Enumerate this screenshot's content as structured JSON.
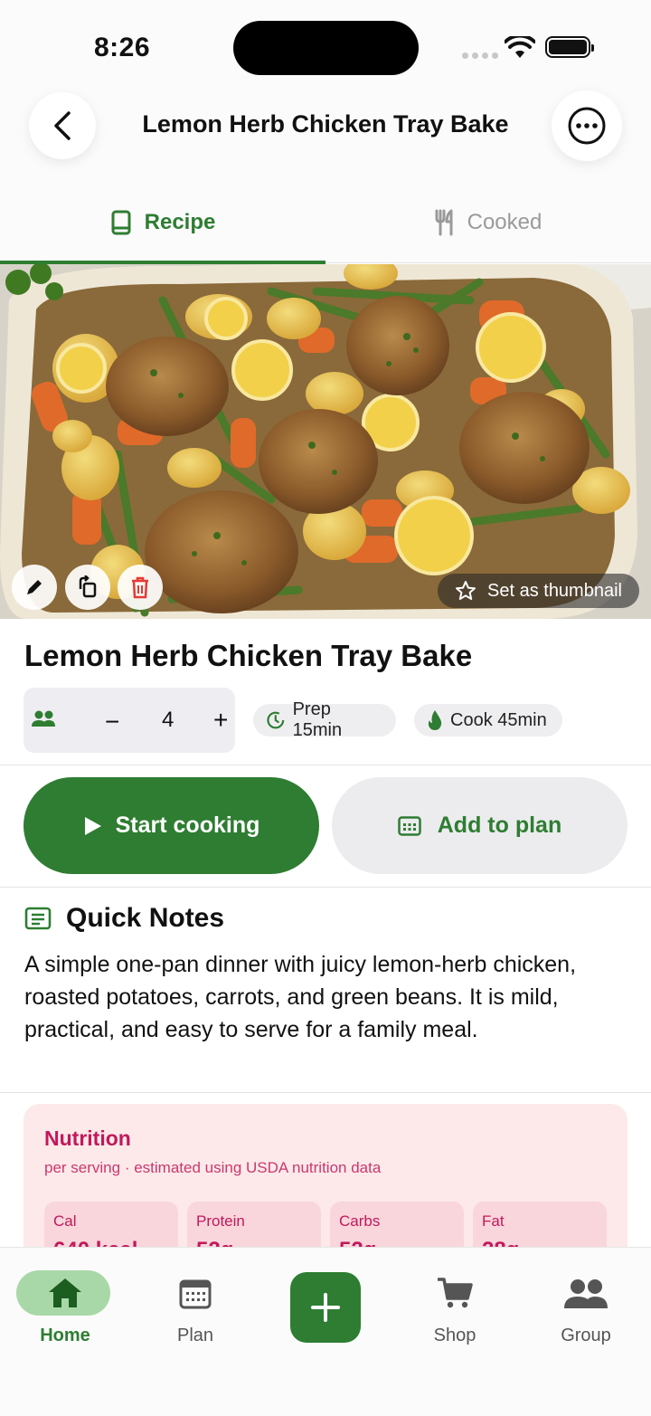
{
  "status": {
    "time": "8:26"
  },
  "header": {
    "title": "Lemon Herb Chicken Tray Bake"
  },
  "tabs": [
    {
      "label": "Recipe",
      "icon": "book-icon",
      "active": true
    },
    {
      "label": "Cooked",
      "icon": "fork-knife-icon",
      "active": false
    }
  ],
  "hero": {
    "thumbnail_label": "Set as thumbnail"
  },
  "recipe": {
    "title": "Lemon Herb Chicken Tray Bake",
    "servings": "4",
    "minus": "−",
    "plus": "+",
    "prep": "Prep 15min",
    "cook": "Cook 45min"
  },
  "actions": {
    "start_cooking": "Start cooking",
    "add_to_plan": "Add to plan"
  },
  "notes": {
    "title": "Quick Notes",
    "body": "A simple one-pan dinner with juicy lemon-herb chicken, roasted potatoes, carrots, and green beans. It is mild, practical, and easy to serve for a family meal."
  },
  "nutrition": {
    "title": "Nutrition",
    "subtitle": "per serving · estimated using USDA nutrition data",
    "items": [
      {
        "label": "Cal",
        "value": "640 kcal"
      },
      {
        "label": "Protein",
        "value": "52g"
      },
      {
        "label": "Carbs",
        "value": "52g"
      },
      {
        "label": "Fat",
        "value": "28g"
      }
    ]
  },
  "nav": {
    "home": "Home",
    "plan": "Plan",
    "shop": "Shop",
    "group": "Group"
  },
  "colors": {
    "accent": "#2e7d32",
    "nutrition_bg": "#fde9e9",
    "nutrition_text": "#c2185b"
  }
}
